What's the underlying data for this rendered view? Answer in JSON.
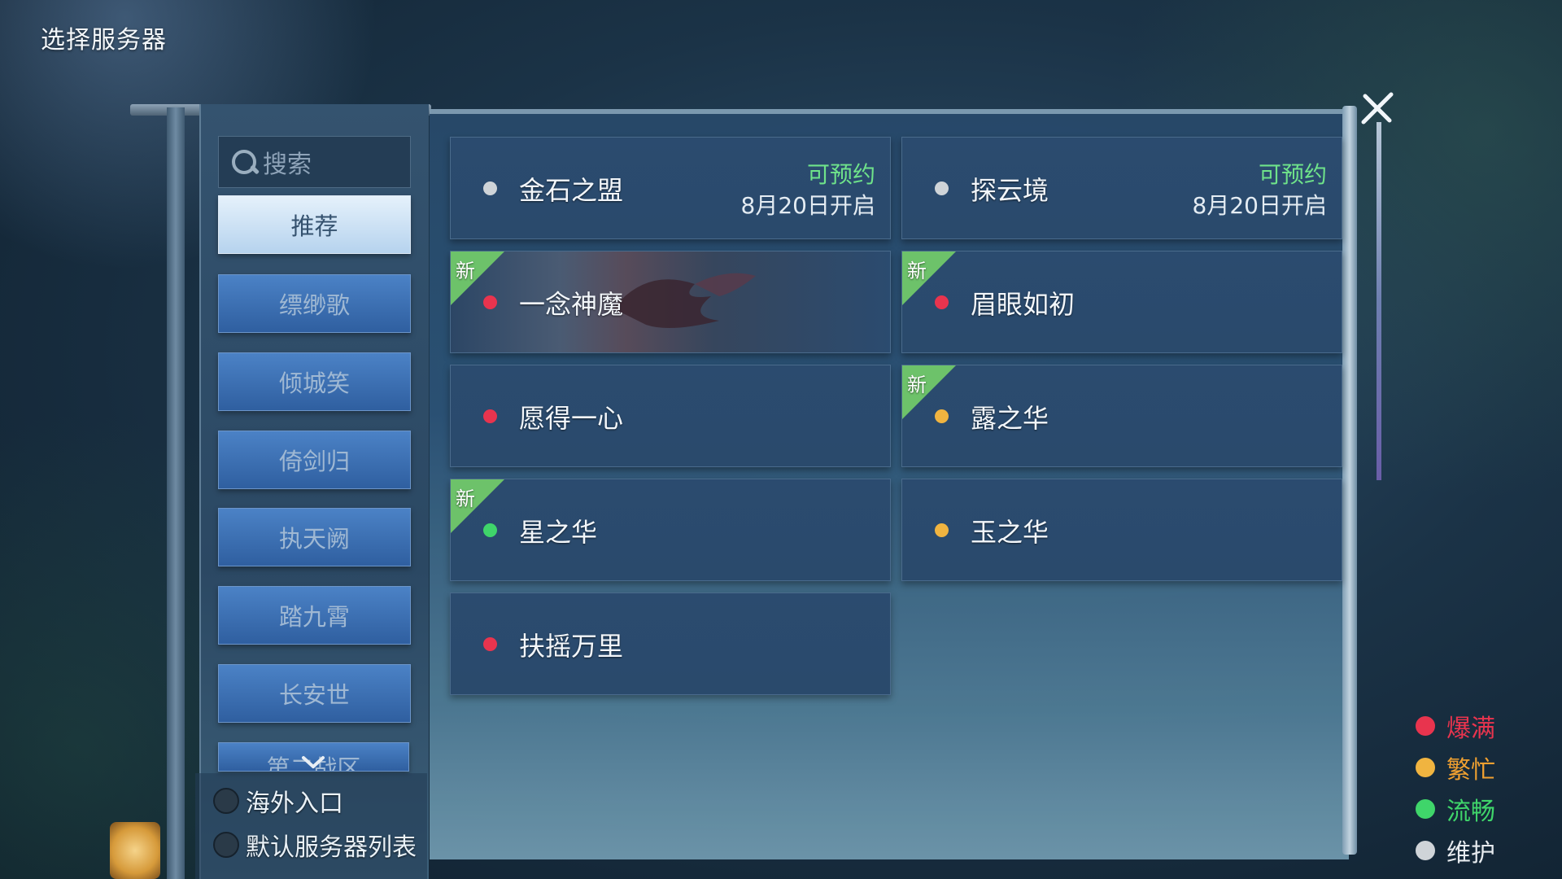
{
  "page_title": "选择服务器",
  "search": {
    "placeholder": "搜索"
  },
  "sidebar": {
    "items": [
      {
        "label": "推荐",
        "active": true
      },
      {
        "label": "缥缈歌"
      },
      {
        "label": "倾城笑"
      },
      {
        "label": "倚剑归"
      },
      {
        "label": "执天阙"
      },
      {
        "label": "踏九霄"
      },
      {
        "label": "长安世"
      },
      {
        "label": "第二战区"
      }
    ]
  },
  "footer_options": [
    {
      "label": "海外入口"
    },
    {
      "label": "默认服务器列表"
    }
  ],
  "servers": [
    {
      "name": "金石之盟",
      "status": "维护",
      "reservation": "可预约",
      "open_date": "8月20日开启",
      "is_new": false
    },
    {
      "name": "探云境",
      "status": "维护",
      "reservation": "可预约",
      "open_date": "8月20日开启",
      "is_new": false
    },
    {
      "name": "一念神魔",
      "status": "爆满",
      "is_new": true,
      "new_label": "新"
    },
    {
      "name": "眉眼如初",
      "status": "爆满",
      "is_new": true,
      "new_label": "新"
    },
    {
      "name": "愿得一心",
      "status": "爆满",
      "is_new": false
    },
    {
      "name": "露之华",
      "status": "繁忙",
      "is_new": true,
      "new_label": "新"
    },
    {
      "name": "星之华",
      "status": "流畅",
      "is_new": true,
      "new_label": "新"
    },
    {
      "name": "玉之华",
      "status": "繁忙",
      "is_new": false
    },
    {
      "name": "扶摇万里",
      "status": "爆满",
      "is_new": false
    }
  ],
  "legend": [
    {
      "label": "爆满",
      "color": "#e8344e"
    },
    {
      "label": "繁忙",
      "color": "#f0b440"
    },
    {
      "label": "流畅",
      "color": "#3fd56a"
    },
    {
      "label": "维护",
      "color": "#cfd4d8"
    }
  ],
  "colors": {
    "full": "#e8344e",
    "busy": "#f0b440",
    "smooth": "#3fd56a",
    "maintenance": "#cfd4d8",
    "reservation_text": "#6fe38a",
    "new_badge": "#6dc26a"
  },
  "icons": [
    "search-icon",
    "close-icon",
    "chevron-down-icon"
  ]
}
